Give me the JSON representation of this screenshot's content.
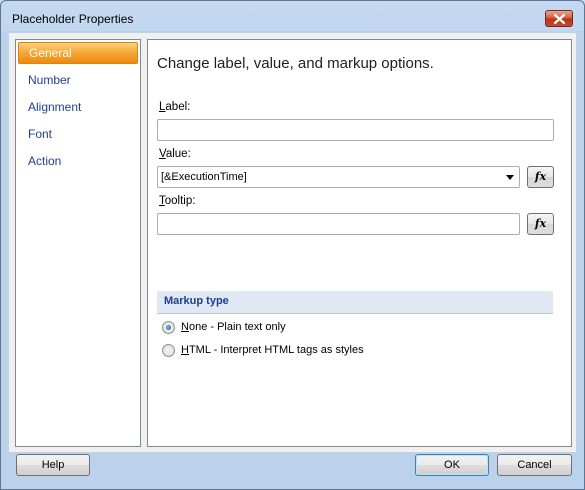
{
  "window": {
    "title": "Placeholder Properties"
  },
  "nav": {
    "items": [
      {
        "label": "General",
        "selected": true
      },
      {
        "label": "Number",
        "selected": false
      },
      {
        "label": "Alignment",
        "selected": false
      },
      {
        "label": "Font",
        "selected": false
      },
      {
        "label": "Action",
        "selected": false
      }
    ]
  },
  "panel": {
    "heading": "Change label, value, and markup options.",
    "label_field": {
      "label_mnemonic": "L",
      "label_rest": "abel:",
      "value": ""
    },
    "value_field": {
      "label_mnemonic": "V",
      "label_rest": "alue:",
      "value": "[&ExecutionTime]"
    },
    "tooltip_field": {
      "label_mnemonic": "T",
      "label_rest": "ooltip:",
      "value": ""
    },
    "fx_label": "fx",
    "markup": {
      "title": "Markup type",
      "options": [
        {
          "mnemonic": "N",
          "rest": "one - Plain text only",
          "checked": true
        },
        {
          "mnemonic": "H",
          "rest": "TML - Interpret HTML tags as styles",
          "checked": false
        }
      ]
    }
  },
  "buttons": {
    "help": "Help",
    "ok": "OK",
    "cancel": "Cancel"
  },
  "colors": {
    "accent_selected": "#f5a230",
    "link_text": "#1f3e8c",
    "section_bar": "#dfe8f3"
  }
}
